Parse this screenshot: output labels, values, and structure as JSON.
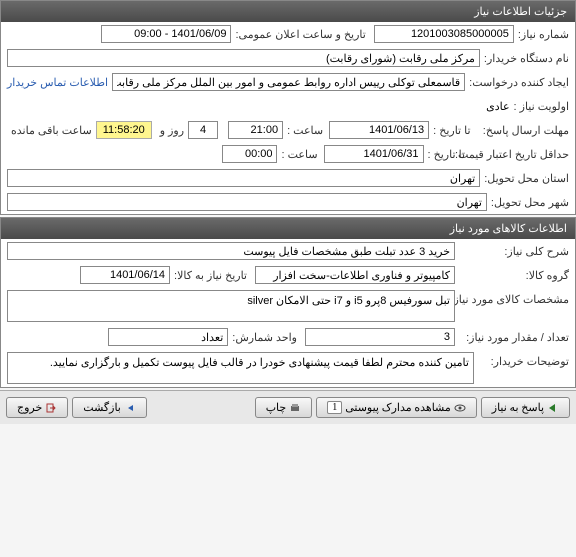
{
  "panel1": {
    "title": "جزئیات اطلاعات نیاز",
    "need_number_label": "شماره نیاز:",
    "need_number": "1201003085000005",
    "announce_label": "تاریخ و ساعت اعلان عمومی:",
    "announce_value": "1401/06/09 - 09:00",
    "buyer_org_label": "نام دستگاه خریدار:",
    "buyer_org": "مرکز ملی رقابت (شورای رقابت)",
    "creator_label": "ایجاد کننده درخواست:",
    "creator": "قاسمعلی توکلی رییس اداره روابط عمومی و امور بین الملل مرکز ملی رقابت (شور",
    "contact_link": "اطلاعات تماس خریدار",
    "priority_label": "اولویت نیاز :",
    "priority": "عادی",
    "deadline_label": "مهلت ارسال پاسخ:",
    "to_date_label": "تا تاریخ :",
    "deadline_date": "1401/06/13",
    "time_label": "ساعت :",
    "deadline_time": "21:00",
    "days_count": "4",
    "days_label": "روز و",
    "countdown": "11:58:20",
    "remaining_label": "ساعت باقی مانده",
    "price_validity_label": "حداقل تاریخ اعتبار قیمت:",
    "price_date": "1401/06/31",
    "price_time": "00:00",
    "delivery_province_label": "استان محل تحویل:",
    "delivery_province": "تهران",
    "delivery_city_label": "شهر محل تحویل:",
    "delivery_city": "تهران"
  },
  "panel2": {
    "title": "اطلاعات کالاهای مورد نیاز",
    "general_desc_label": "شرح کلی نیاز:",
    "general_desc": "خرید 3 عدد تبلت طبق مشخصات فایل پیوست",
    "goods_group_label": "گروه کالا:",
    "goods_group": "کامپیوتر و فناوری اطلاعات-سخت افزار",
    "need_date_label": "تاریخ نیاز به کالا:",
    "need_date": "1401/06/14",
    "specs_label": "مشخصات کالای مورد نیاز:",
    "specs": "تبل سورفیس 8پرو i5 و i7 حتی الامکان silver",
    "qty_label": "تعداد / مقدار مورد نیاز:",
    "qty": "3",
    "unit_label": "واحد شمارش:",
    "unit": "تعداد",
    "buyer_notes_label": "توضیحات خریدار:",
    "buyer_notes": "تامین کننده محترم لطفا قیمت پیشنهادی خودرا در قالب فایل پیوست تکمیل و بارگزاری نمایید."
  },
  "footer": {
    "reply": "پاسخ به نیاز",
    "attachments": "مشاهده مدارک پیوستی",
    "attachments_count": "1",
    "print": "چاپ",
    "back": "بازگشت",
    "exit": "خروج"
  }
}
